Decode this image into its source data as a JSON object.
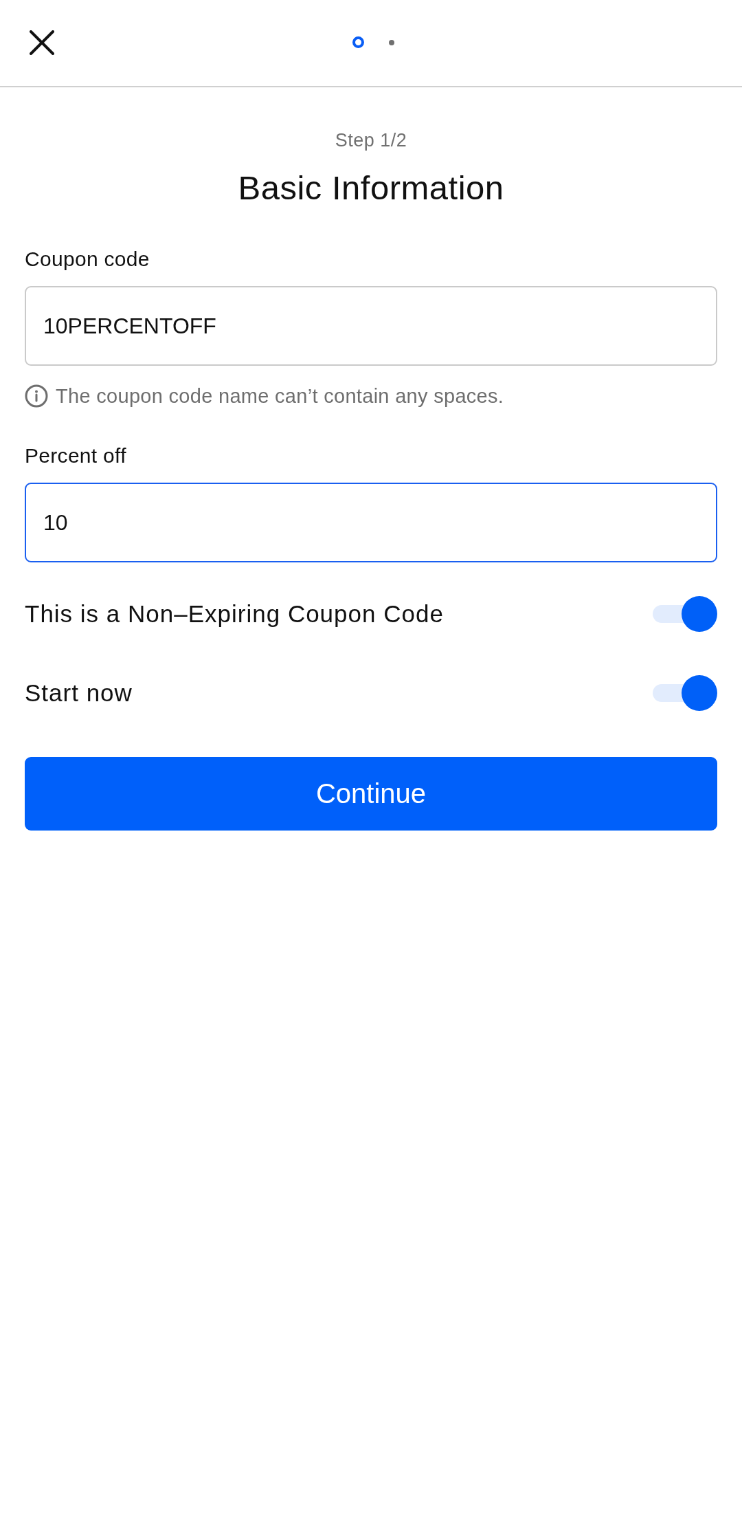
{
  "top_bar": {
    "step_dots": [
      {
        "selected": true
      },
      {
        "selected": false
      }
    ]
  },
  "header": {
    "step": "Step 1/2",
    "title": "Basic Information"
  },
  "fields": [
    {
      "label": "Coupon code",
      "value": "10PERCENTOFF",
      "focused": false,
      "hint": "The coupon code name can’t contain any spaces."
    },
    {
      "label": "Percent off",
      "value": "10",
      "focused": true
    }
  ],
  "toggles": [
    {
      "label": "This is a Non–Expiring Coupon Code",
      "on": true
    },
    {
      "label": "Start now",
      "on": true
    }
  ],
  "buttons": [
    {
      "label": "Continue"
    }
  ]
}
